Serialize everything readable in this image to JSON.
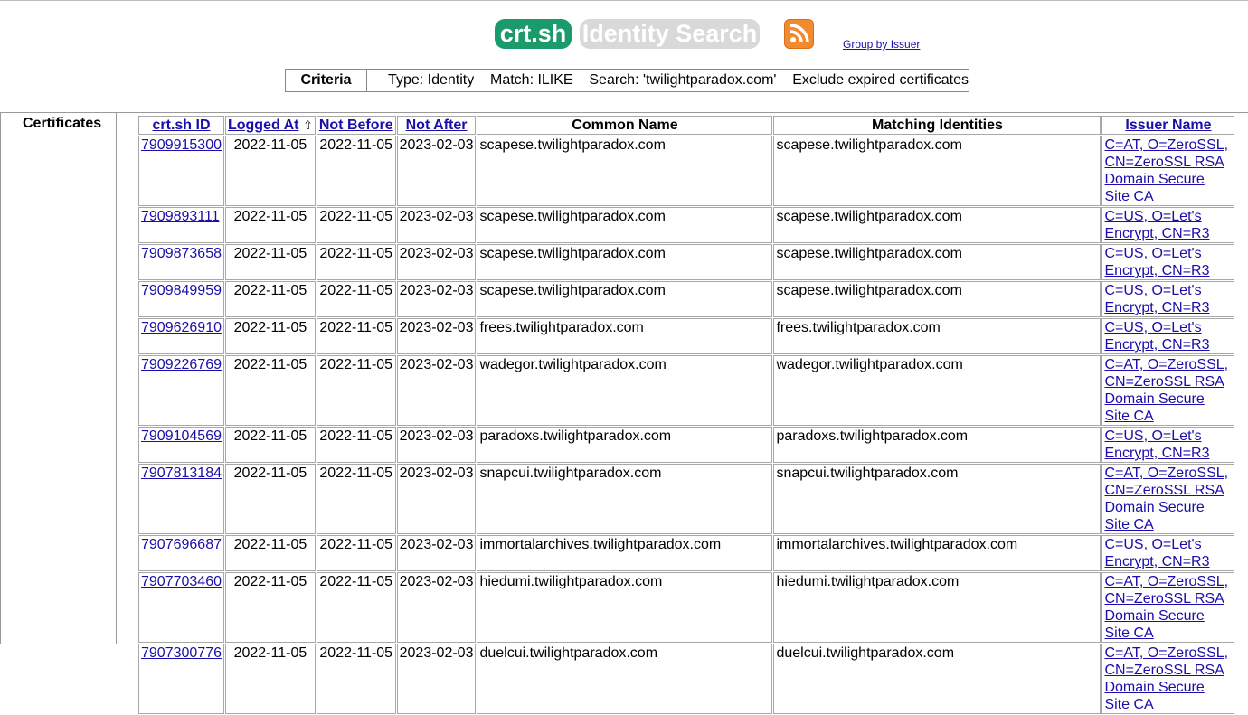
{
  "header": {
    "logo_text": "crt.sh",
    "mode_text": "Identity Search",
    "rss_icon": "rss-feed-icon",
    "group_link": "Group by Issuer"
  },
  "criteria": {
    "label": "Criteria",
    "text": "Type: Identity    Match: ILIKE    Search: 'twilightparadox.com'    Exclude expired certificates"
  },
  "section_label": "Certificates",
  "table": {
    "columns": [
      "crt.sh ID",
      "Logged At",
      "Not Before",
      "Not After",
      "Common Name",
      "Matching Identities",
      "Issuer Name"
    ],
    "sort_indicator": "⇧",
    "rows": [
      {
        "id": "7909915300",
        "logged": "2022-11-05",
        "not_before": "2022-11-05",
        "not_after": "2023-02-03",
        "cn": "scapese.twilightparadox.com",
        "match": "scapese.twilightparadox.com",
        "issuer": "C=AT, O=ZeroSSL, CN=ZeroSSL RSA Domain Secure Site CA"
      },
      {
        "id": "7909893111",
        "logged": "2022-11-05",
        "not_before": "2022-11-05",
        "not_after": "2023-02-03",
        "cn": "scapese.twilightparadox.com",
        "match": "scapese.twilightparadox.com",
        "issuer": "C=US, O=Let's Encrypt, CN=R3"
      },
      {
        "id": "7909873658",
        "logged": "2022-11-05",
        "not_before": "2022-11-05",
        "not_after": "2023-02-03",
        "cn": "scapese.twilightparadox.com",
        "match": "scapese.twilightparadox.com",
        "issuer": "C=US, O=Let's Encrypt, CN=R3"
      },
      {
        "id": "7909849959",
        "logged": "2022-11-05",
        "not_before": "2022-11-05",
        "not_after": "2023-02-03",
        "cn": "scapese.twilightparadox.com",
        "match": "scapese.twilightparadox.com",
        "issuer": "C=US, O=Let's Encrypt, CN=R3"
      },
      {
        "id": "7909626910",
        "logged": "2022-11-05",
        "not_before": "2022-11-05",
        "not_after": "2023-02-03",
        "cn": "frees.twilightparadox.com",
        "match": "frees.twilightparadox.com",
        "issuer": "C=US, O=Let's Encrypt, CN=R3"
      },
      {
        "id": "7909226769",
        "logged": "2022-11-05",
        "not_before": "2022-11-05",
        "not_after": "2023-02-03",
        "cn": "wadegor.twilightparadox.com",
        "match": "wadegor.twilightparadox.com",
        "issuer": "C=AT, O=ZeroSSL, CN=ZeroSSL RSA Domain Secure Site CA"
      },
      {
        "id": "7909104569",
        "logged": "2022-11-05",
        "not_before": "2022-11-05",
        "not_after": "2023-02-03",
        "cn": "paradoxs.twilightparadox.com",
        "match": "paradoxs.twilightparadox.com",
        "issuer": "C=US, O=Let's Encrypt, CN=R3"
      },
      {
        "id": "7907813184",
        "logged": "2022-11-05",
        "not_before": "2022-11-05",
        "not_after": "2023-02-03",
        "cn": "snapcui.twilightparadox.com",
        "match": "snapcui.twilightparadox.com",
        "issuer": "C=AT, O=ZeroSSL, CN=ZeroSSL RSA Domain Secure Site CA"
      },
      {
        "id": "7907696687",
        "logged": "2022-11-05",
        "not_before": "2022-11-05",
        "not_after": "2023-02-03",
        "cn": "immortalarchives.twilightparadox.com",
        "match": "immortalarchives.twilightparadox.com",
        "issuer": "C=US, O=Let's Encrypt, CN=R3"
      },
      {
        "id": "7907703460",
        "logged": "2022-11-05",
        "not_before": "2022-11-05",
        "not_after": "2023-02-03",
        "cn": "hiedumi.twilightparadox.com",
        "match": "hiedumi.twilightparadox.com",
        "issuer": "C=AT, O=ZeroSSL, CN=ZeroSSL RSA Domain Secure Site CA"
      },
      {
        "id": "7907300776",
        "logged": "2022-11-05",
        "not_before": "2022-11-05",
        "not_after": "2023-02-03",
        "cn": "duelcui.twilightparadox.com",
        "match": "duelcui.twilightparadox.com",
        "issuer": "C=AT, O=ZeroSSL, CN=ZeroSSL RSA Domain Secure Site CA"
      }
    ]
  }
}
